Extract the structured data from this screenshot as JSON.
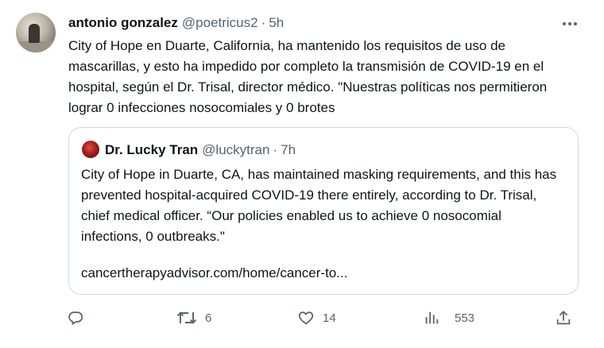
{
  "tweet": {
    "author_name": "antonio gonzalez",
    "author_handle": "@poetricus2",
    "separator": "·",
    "time": "5h",
    "text": "City of Hope en Duarte, California, ha mantenido los requisitos de uso de mascarillas, y esto ha impedido por completo la transmisión de COVID-19 en el hospital, según el Dr. Trisal, director médico. \"Nuestras políticas nos permitieron lograr 0 infecciones nosocomiales y 0 brotes"
  },
  "quote": {
    "author_name": "Dr. Lucky Tran",
    "author_handle": "@luckytran",
    "separator": "·",
    "time": "7h",
    "text": "City of Hope in Duarte, CA, has maintained masking requirements, and this has prevented hospital-acquired COVID-19 there entirely, according to Dr. Trisal, chief medical officer. “Our policies enabled us to achieve 0 nosocomial infections, 0 outbreaks.\"",
    "link": "cancertherapyadvisor.com/home/cancer-to..."
  },
  "actions": {
    "reply_count": "",
    "retweet_count": "6",
    "like_count": "14",
    "views_count": "553"
  },
  "icons": {
    "more": "more-dots-icon",
    "reply": "reply-bubble-icon",
    "retweet": "retweet-arrows-icon",
    "like": "heart-icon",
    "views": "bar-chart-icon",
    "share": "share-upload-icon"
  },
  "colors": {
    "text": "#0f1419",
    "secondary": "#536471",
    "border": "#cfd9de",
    "background": "#ffffff"
  }
}
